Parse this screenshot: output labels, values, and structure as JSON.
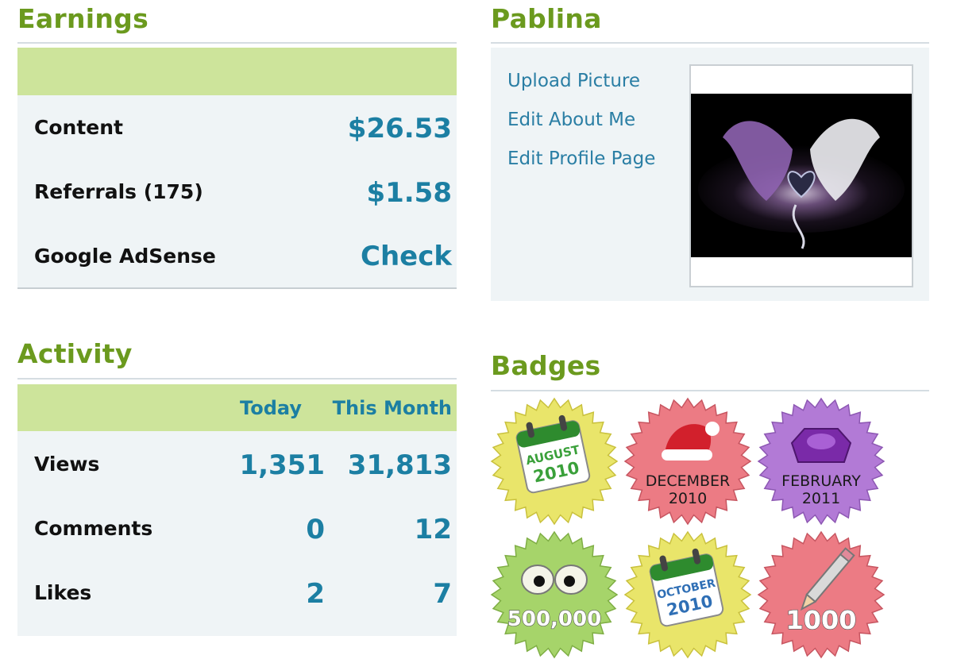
{
  "earnings": {
    "title": "Earnings",
    "rows": [
      {
        "label": "Content",
        "value": "$26.53"
      },
      {
        "label": "Referrals (175)",
        "value": "$1.58"
      },
      {
        "label": "Google AdSense",
        "value": "Check"
      }
    ]
  },
  "profile": {
    "title": "Pablina",
    "links": [
      "Upload Picture",
      "Edit About Me",
      "Edit Profile Page"
    ]
  },
  "activity": {
    "title": "Activity",
    "columns": [
      "Today",
      "This Month"
    ],
    "rows": [
      {
        "label": "Views",
        "today": "1,351",
        "month": "31,813"
      },
      {
        "label": "Comments",
        "today": "0",
        "month": "12"
      },
      {
        "label": "Likes",
        "today": "2",
        "month": "7"
      }
    ]
  },
  "badges": {
    "title": "Badges",
    "items": [
      {
        "line1": "AUGUST",
        "line2": "2010",
        "kind": "calendar",
        "color": "#e9e56a"
      },
      {
        "line1": "DECEMBER",
        "line2": "2010",
        "kind": "santa-hat",
        "color": "#ec7b84"
      },
      {
        "line1": "FEBRUARY",
        "line2": "2011",
        "kind": "gem",
        "color": "#b27ad6"
      },
      {
        "line1": "500,000",
        "kind": "eyes",
        "color": "#a6d46a"
      },
      {
        "line1": "OCTOBER",
        "line2": "2010",
        "kind": "calendar",
        "color": "#e9e56a"
      },
      {
        "line1": "1000",
        "kind": "pencil",
        "color": "#ec7b84"
      }
    ]
  },
  "colors": {
    "accent_green": "#6b9a1e",
    "value_blue": "#1c7fa3",
    "band_green": "#cde49b",
    "panel_bg": "#eff4f6"
  }
}
